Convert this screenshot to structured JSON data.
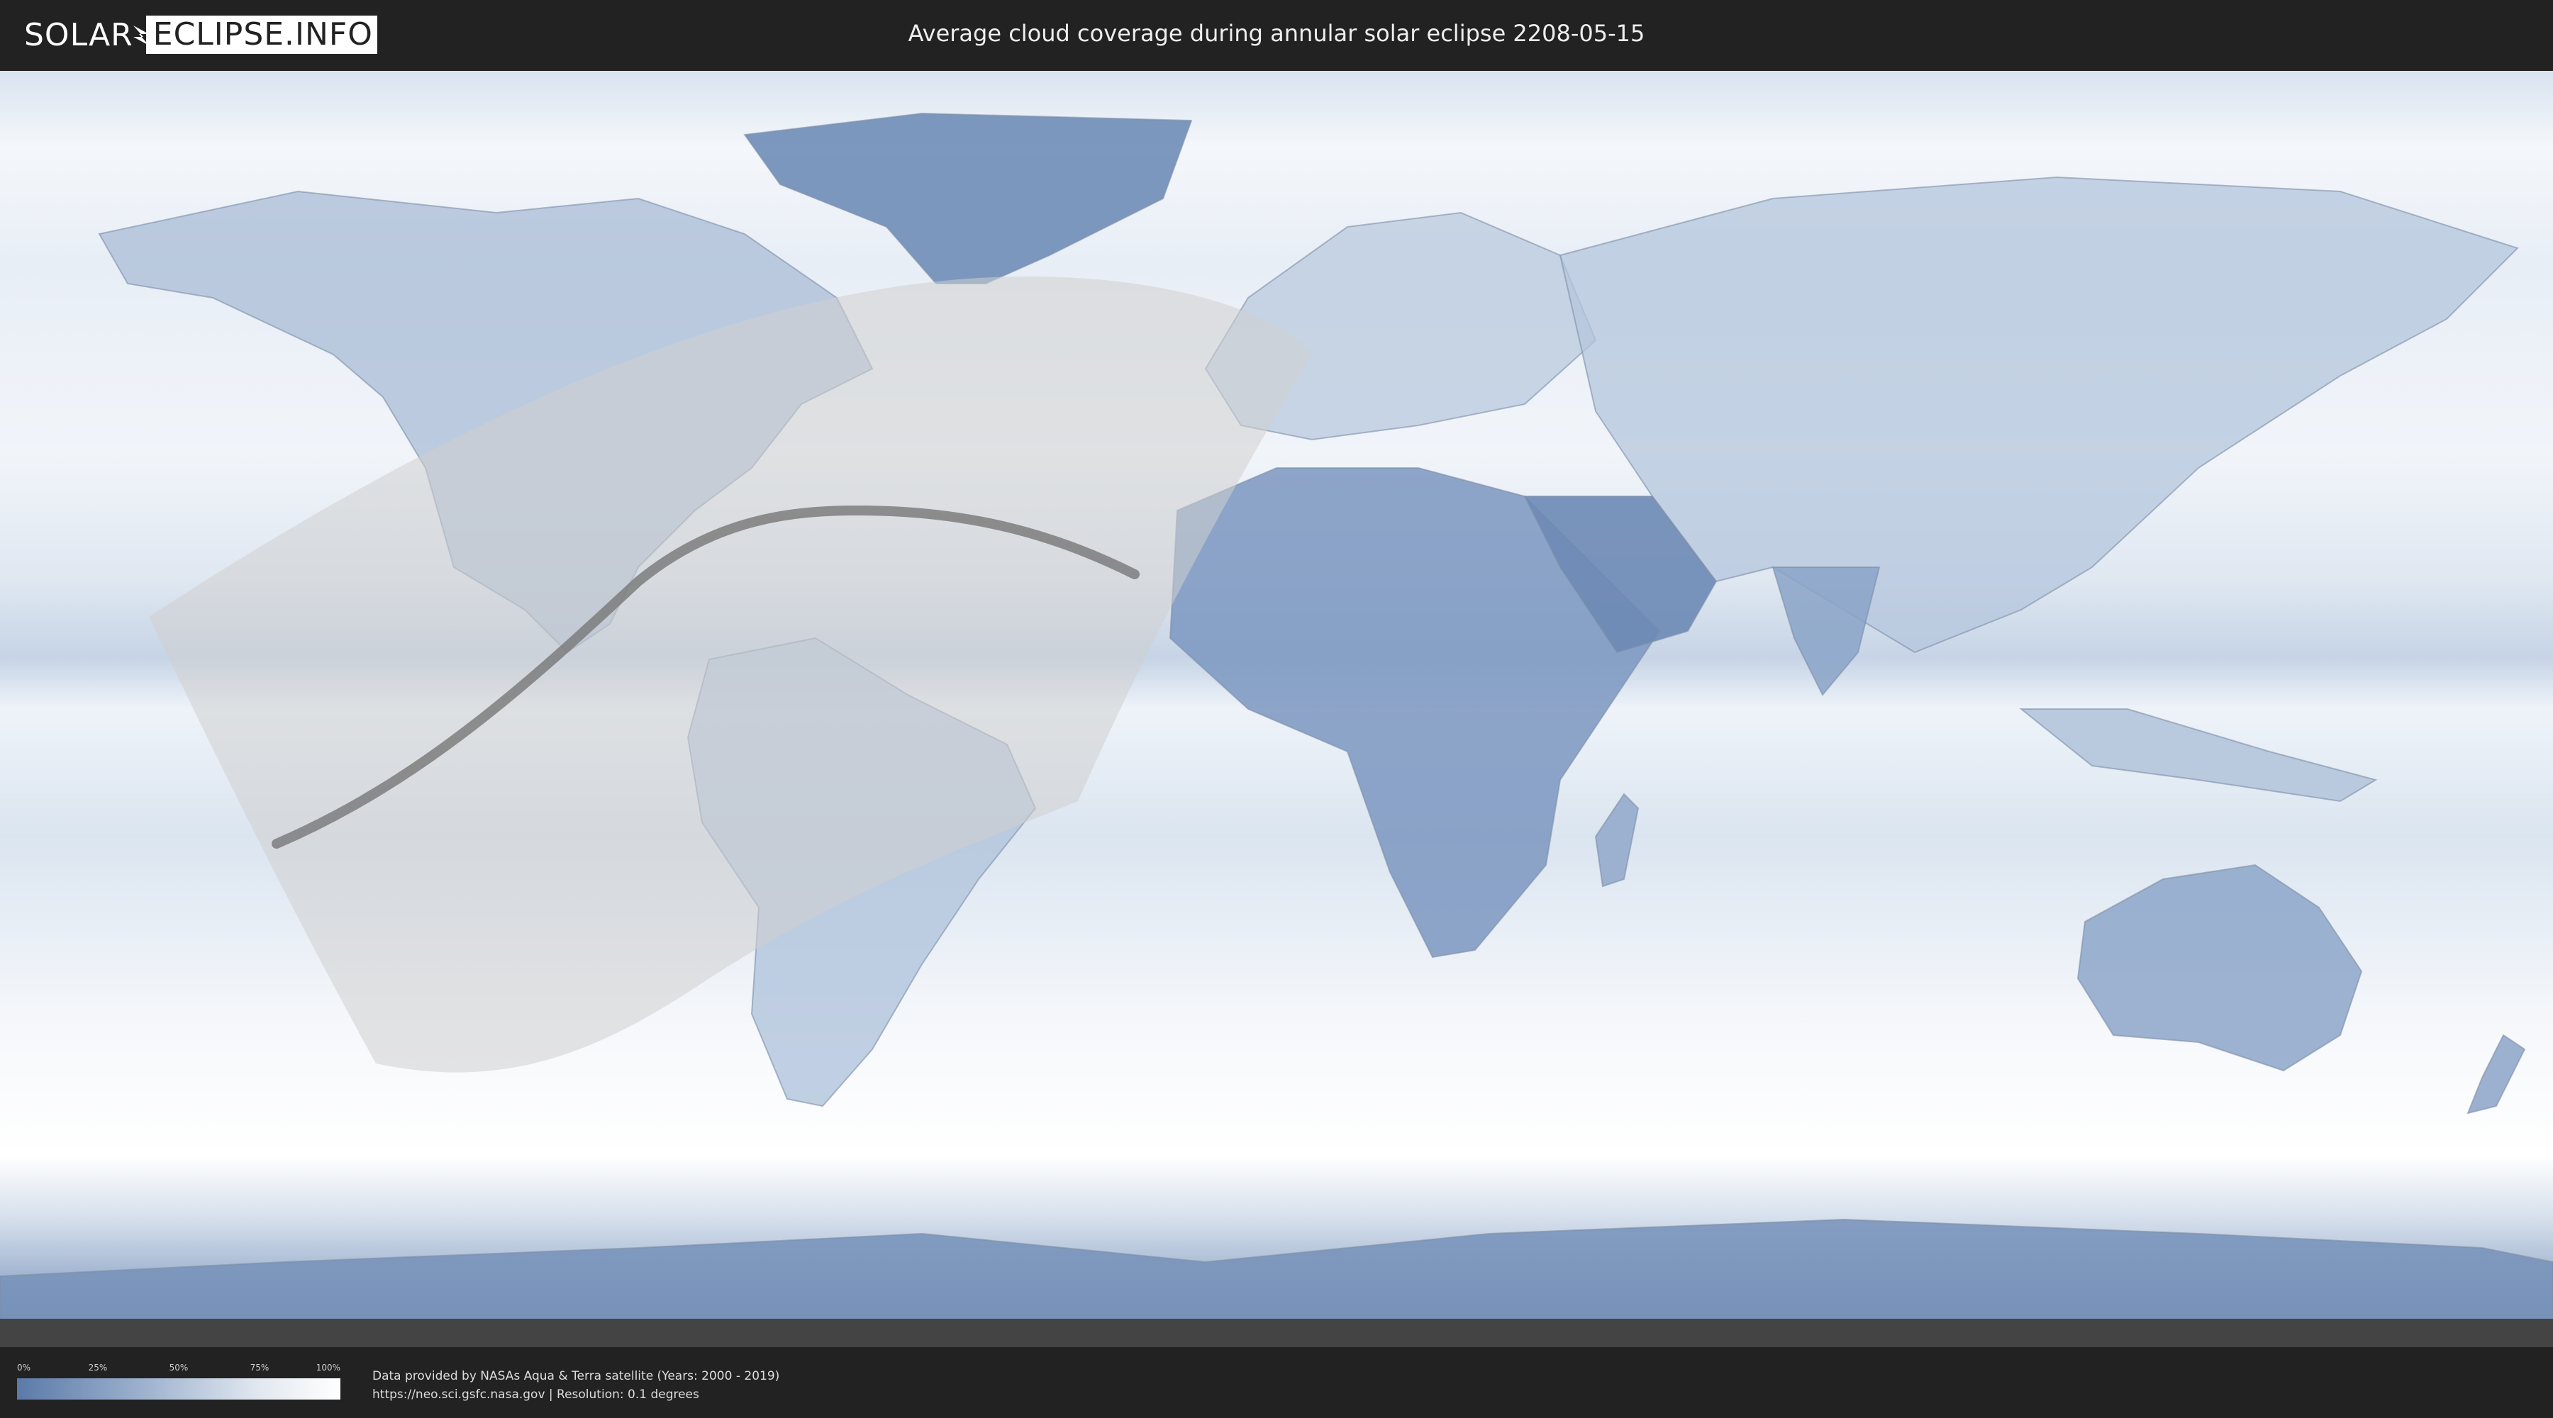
{
  "header": {
    "logo_left": "SOLAR",
    "logo_right": "ECLIPSE.INFO",
    "title": "Average cloud coverage during annular solar eclipse 2208-05-15"
  },
  "legend": {
    "ticks": [
      "0%",
      "25%",
      "50%",
      "75%",
      "100%"
    ],
    "gradient_colors": [
      "#5b7aa8",
      "#9fb3cf",
      "#e2e8f0",
      "#ffffff"
    ]
  },
  "footer": {
    "credit_line1": "Data provided by NASAs Aqua & Terra satellite (Years: 2000 - 2019)",
    "credit_line2": "https://neo.sci.gsfc.nasa.gov | Resolution: 0.1 degrees"
  },
  "map": {
    "projection": "equirectangular",
    "ocean_color": "#eef3f9",
    "cloud_light": "#f4f7fb",
    "cloud_dark": "#5f7fab",
    "eclipse_zone_color": "#cfcfcf",
    "central_line_color": "#777777",
    "coastline_color": "#7d8ea6"
  }
}
